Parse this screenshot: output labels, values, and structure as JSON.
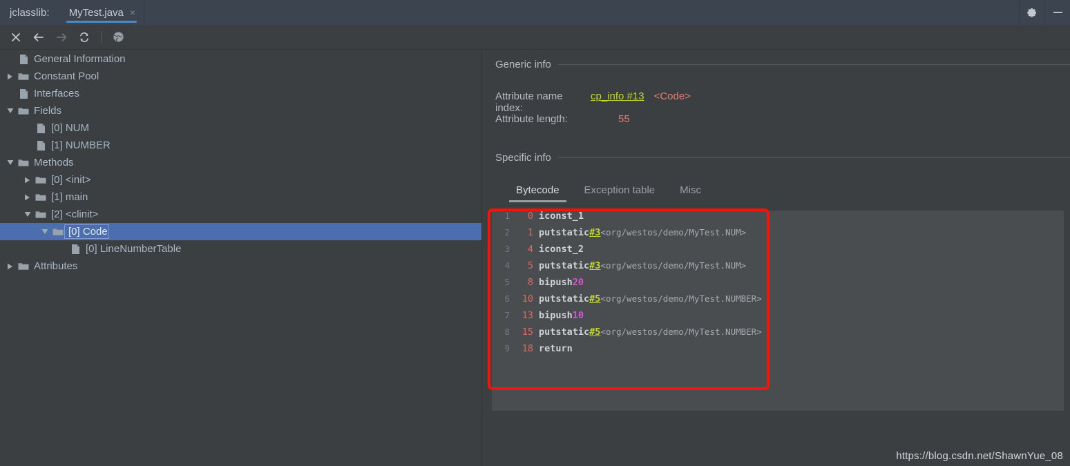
{
  "titlebar": {
    "app_label": "jclasslib:",
    "tab_label": "MyTest.java",
    "tab_close": "×",
    "gear_icon": "gear-icon",
    "minimize_icon": "minimize-icon"
  },
  "toolbar": {
    "buttons": [
      {
        "name": "close-button",
        "icon": "close-icon",
        "enabled": true
      },
      {
        "name": "back-button",
        "icon": "arrow-left-icon",
        "enabled": true
      },
      {
        "name": "forward-button",
        "icon": "arrow-right-icon",
        "enabled": false
      },
      {
        "name": "reload-button",
        "icon": "reload-icon",
        "enabled": true
      },
      {
        "name": "browse-button",
        "icon": "globe-icon",
        "enabled": true
      }
    ]
  },
  "tree": {
    "items": [
      {
        "label": "General Information",
        "indent": 0,
        "twisty": "none",
        "icon": "file-icon",
        "selected": false
      },
      {
        "label": "Constant Pool",
        "indent": 0,
        "twisty": "collapsed",
        "icon": "folder-icon",
        "selected": false
      },
      {
        "label": "Interfaces",
        "indent": 0,
        "twisty": "none",
        "icon": "file-icon",
        "selected": false
      },
      {
        "label": "Fields",
        "indent": 0,
        "twisty": "expanded",
        "icon": "folder-icon",
        "selected": false
      },
      {
        "label": "[0] NUM",
        "indent": 1,
        "twisty": "none",
        "icon": "file-icon",
        "selected": false
      },
      {
        "label": "[1] NUMBER",
        "indent": 1,
        "twisty": "none",
        "icon": "file-icon",
        "selected": false
      },
      {
        "label": "Methods",
        "indent": 0,
        "twisty": "expanded",
        "icon": "folder-icon",
        "selected": false
      },
      {
        "label": "[0] <init>",
        "indent": 1,
        "twisty": "collapsed",
        "icon": "folder-icon",
        "selected": false
      },
      {
        "label": "[1] main",
        "indent": 1,
        "twisty": "collapsed",
        "icon": "folder-icon",
        "selected": false
      },
      {
        "label": "[2] <clinit>",
        "indent": 1,
        "twisty": "expanded",
        "icon": "folder-icon",
        "selected": false
      },
      {
        "label": "[0] Code",
        "indent": 2,
        "twisty": "expanded",
        "icon": "folder-icon",
        "selected": true
      },
      {
        "label": "[0] LineNumberTable",
        "indent": 3,
        "twisty": "none",
        "icon": "file-icon",
        "selected": false
      },
      {
        "label": "Attributes",
        "indent": 0,
        "twisty": "collapsed",
        "icon": "folder-icon",
        "selected": false
      }
    ]
  },
  "detail": {
    "generic_info_title": "Generic info",
    "attribute_name_index_label": "Attribute name index:",
    "attribute_name_index_link": "cp_info #13",
    "attribute_name_index_note": "<Code>",
    "attribute_length_label": "Attribute length:",
    "attribute_length_value": "55",
    "specific_info_title": "Specific info",
    "tabs": [
      {
        "label": "Bytecode",
        "active": true
      },
      {
        "label": "Exception table",
        "active": false
      },
      {
        "label": "Misc",
        "active": false
      }
    ]
  },
  "bytecode": {
    "lines": [
      {
        "line": "1",
        "offset": "0",
        "opcode": "iconst_1",
        "cpref": "",
        "immediate": "",
        "comment": ""
      },
      {
        "line": "2",
        "offset": "1",
        "opcode": "putstatic",
        "cpref": "#3",
        "immediate": "",
        "comment": "<org/westos/demo/MyTest.NUM>"
      },
      {
        "line": "3",
        "offset": "4",
        "opcode": "iconst_2",
        "cpref": "",
        "immediate": "",
        "comment": ""
      },
      {
        "line": "4",
        "offset": "5",
        "opcode": "putstatic",
        "cpref": "#3",
        "immediate": "",
        "comment": "<org/westos/demo/MyTest.NUM>"
      },
      {
        "line": "5",
        "offset": "8",
        "opcode": "bipush",
        "cpref": "",
        "immediate": "20",
        "comment": ""
      },
      {
        "line": "6",
        "offset": "10",
        "opcode": "putstatic",
        "cpref": "#5",
        "immediate": "",
        "comment": "<org/westos/demo/MyTest.NUMBER>"
      },
      {
        "line": "7",
        "offset": "13",
        "opcode": "bipush",
        "cpref": "",
        "immediate": "10",
        "comment": ""
      },
      {
        "line": "8",
        "offset": "15",
        "opcode": "putstatic",
        "cpref": "#5",
        "immediate": "",
        "comment": "<org/westos/demo/MyTest.NUMBER>"
      },
      {
        "line": "9",
        "offset": "18",
        "opcode": "return",
        "cpref": "",
        "immediate": "",
        "comment": ""
      }
    ]
  },
  "annotation": {
    "highlight_color": "#fb1206"
  },
  "watermark": {
    "text": "https://blog.csdn.net/ShawnYue_08"
  },
  "colors": {
    "titlebar_bg": "#3c4450",
    "panel_bg": "#3c3f41",
    "code_bg": "#4a4d4f",
    "selection_blue": "#4b6eaf",
    "tab_underline": "#4a88c7",
    "link_green": "#c2d731",
    "value_red": "#e27f72",
    "offset_red": "#e0685c",
    "immediate_magenta": "#d653d6"
  }
}
